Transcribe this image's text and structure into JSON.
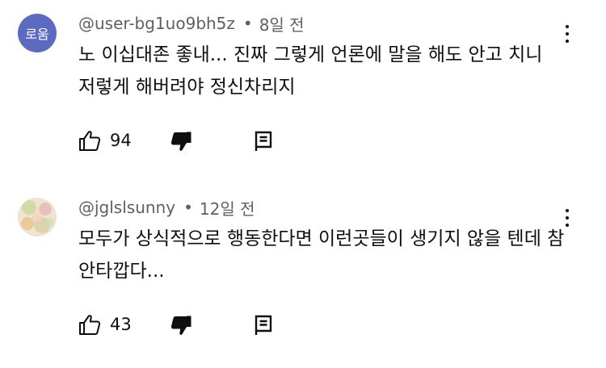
{
  "comments": [
    {
      "author": "@user-bg1uo9bh5z",
      "separator": "•",
      "time": "8일 전",
      "avatar": {
        "text": "로움",
        "color": "#5c6bc0"
      },
      "text": "노 이십대존 좋내... 진짜 그렇게 언론에 말을 해도 안고 치니 저렇게 해버려야 정신차리지",
      "likes": "94"
    },
    {
      "author": "@jglslsunny",
      "separator": "•",
      "time": "12일 전",
      "avatar": {
        "text": "",
        "color": "#e6d7c0"
      },
      "text": "모두가 상식적으로 행동한다면 이런곳들이 생기지 않을 텐데 참 안타깝다...",
      "likes": "43"
    }
  ],
  "icons": {
    "like": "thumbs-up-icon",
    "dislike": "thumbs-down-icon",
    "reply": "reply-icon",
    "more": "more-vertical-icon"
  },
  "colors": {
    "text": "#0f0f0f",
    "meta": "#606060",
    "avatar1": "#5c6bc0"
  }
}
